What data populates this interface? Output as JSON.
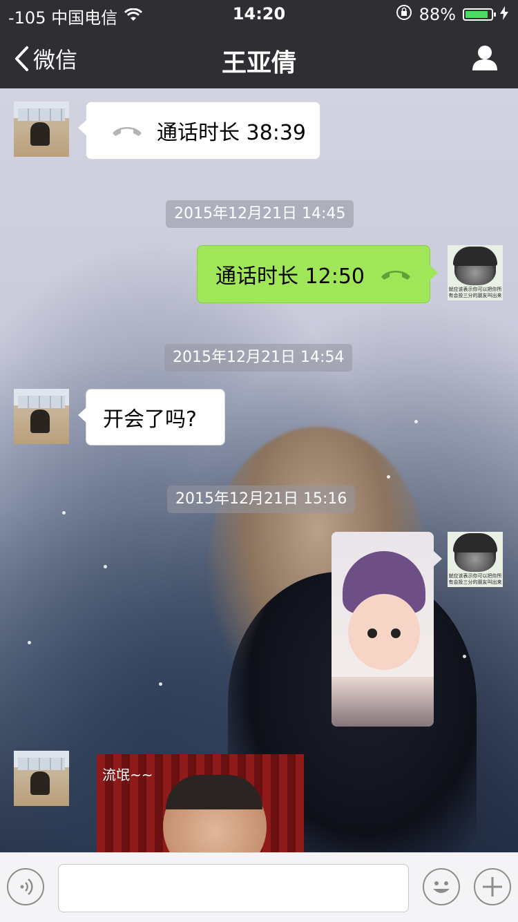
{
  "status_bar": {
    "carrier": "-105 中国电信",
    "time": "14:20",
    "battery_percent": "88%",
    "battery_level": 0.88
  },
  "nav": {
    "back_label": "微信",
    "title": "王亚倩"
  },
  "messages": {
    "call1": "通话时长 38:39",
    "ts1": "2015年12月21日 14:45",
    "call2": "通话时长 12:50",
    "ts2": "2015年12月21日 14:54",
    "text1": "开会了吗?",
    "ts3": "2015年12月21日 15:16",
    "gif_caption": "流氓~~"
  },
  "sticker_caption": "就应该表示你可以把你所有会投三分的朋友叫出来",
  "input": {
    "placeholder": ""
  },
  "colors": {
    "bar": "#2e2e33",
    "sent_bubble": "#9fe658",
    "battery": "#4cd964"
  }
}
